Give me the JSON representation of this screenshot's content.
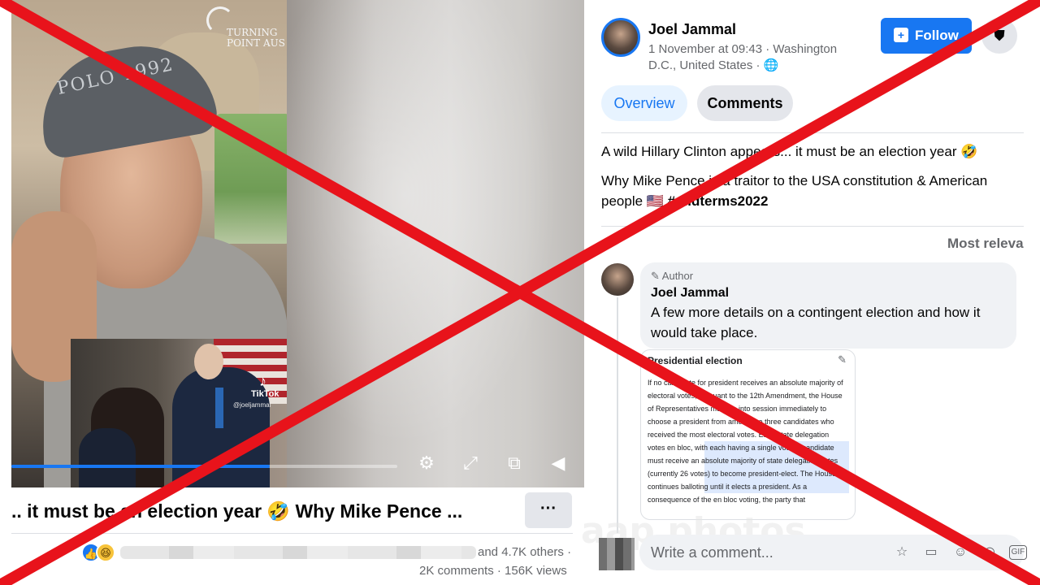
{
  "video": {
    "brand_text": "TURNING POINT AUS",
    "cap_text": "POLO 1992",
    "tiktok_logo_label": "TikTok",
    "tiktok_handle": "@joeljammal",
    "progress_percent": 67,
    "controls": [
      {
        "name": "settings-icon",
        "glyph": "⚙"
      },
      {
        "name": "fullscreen-icon",
        "glyph": "⤢"
      },
      {
        "name": "miniplayer-icon",
        "glyph": "⧉"
      },
      {
        "name": "volume-icon",
        "glyph": "◀"
      }
    ],
    "title": ".. it must be an election year 🤣 Why Mike Pence ...",
    "more_label": "···",
    "reactions": {
      "like_glyph": "👍",
      "haha_glyph": "😆"
    },
    "others_text": "and 4.7K others ·",
    "stats_text": "2K comments · 156K views"
  },
  "post": {
    "author": "Joel Jammal",
    "meta": "1 November at 09:43 · Washington D.C., United States · 🌐",
    "follow_label": "Follow",
    "tabs": [
      {
        "label": "Overview",
        "active": true
      },
      {
        "label": "Comments",
        "active": false
      }
    ],
    "line1": "A wild Hillary Clinton appears... it must be an election year 🤣",
    "line2_text": "Why Mike Pence is a traitor to the USA constitution & American people 🇺🇸 ",
    "hashtag": "#midterms2022",
    "sort_label": "Most releva"
  },
  "comment": {
    "badge": "✎ Author",
    "name": "Joel Jammal",
    "text": "A few more details on a contingent election and how it would take place.",
    "doc": {
      "title": "Presidential election",
      "body": "If no candidate for president receives an absolute majority of electoral votes, pursuant to the 12th Amendment, the House of Representatives must go into session immediately to choose a president from among the three candidates who received the most electoral votes. Each state delegation votes en bloc, with each having a single vote. A candidate must receive an absolute majority of state delegation votes (currently 26 votes) to become president-elect. The House continues balloting until it elects a president. As a consequence of the en bloc voting, the party that"
    }
  },
  "composer": {
    "placeholder": "Write a comment...",
    "icons": [
      {
        "name": "avatar-sticker-icon",
        "glyph": "☆"
      },
      {
        "name": "sticker-icon",
        "glyph": "▭"
      },
      {
        "name": "emoji-icon",
        "glyph": "☺"
      },
      {
        "name": "camera-icon",
        "glyph": "◎"
      },
      {
        "name": "gif-icon",
        "glyph": "GIF"
      }
    ]
  },
  "watermark_text": "aap photos",
  "colors": {
    "accent": "#1877f2",
    "overlay_x": "#e8131b"
  }
}
